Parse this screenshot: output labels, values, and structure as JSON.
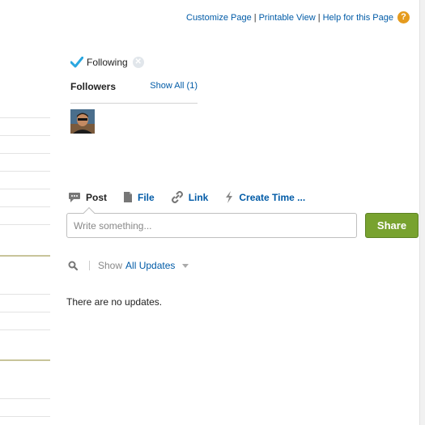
{
  "top_links": {
    "customize": "Customize Page",
    "printable": "Printable View",
    "help": "Help for this Page",
    "separator": "|",
    "help_icon_glyph": "?",
    "help_icon": "help-icon"
  },
  "following": {
    "label": "Following",
    "check_icon": "check-icon",
    "unfollow_icon": "unfollow-icon"
  },
  "followers": {
    "title": "Followers",
    "show_all": "Show All (1)"
  },
  "publisher": {
    "actions": [
      {
        "label": "Post",
        "icon": "speech-bubble-icon",
        "active": true
      },
      {
        "label": "File",
        "icon": "file-icon",
        "active": false
      },
      {
        "label": "Link",
        "icon": "link-icon",
        "active": false
      },
      {
        "label": "Create Time ...",
        "icon": "lightning-icon",
        "active": false
      }
    ],
    "placeholder": "Write something...",
    "share_label": "Share"
  },
  "feed_filter": {
    "show_label": "Show",
    "selected": "All Updates",
    "search_icon": "search-icon"
  },
  "feed": {
    "empty_message": "There are no updates."
  },
  "colors": {
    "link": "#015ba7",
    "share_button": "#78a22f",
    "help_icon": "#e59b1e",
    "check": "#2aa7e0"
  }
}
